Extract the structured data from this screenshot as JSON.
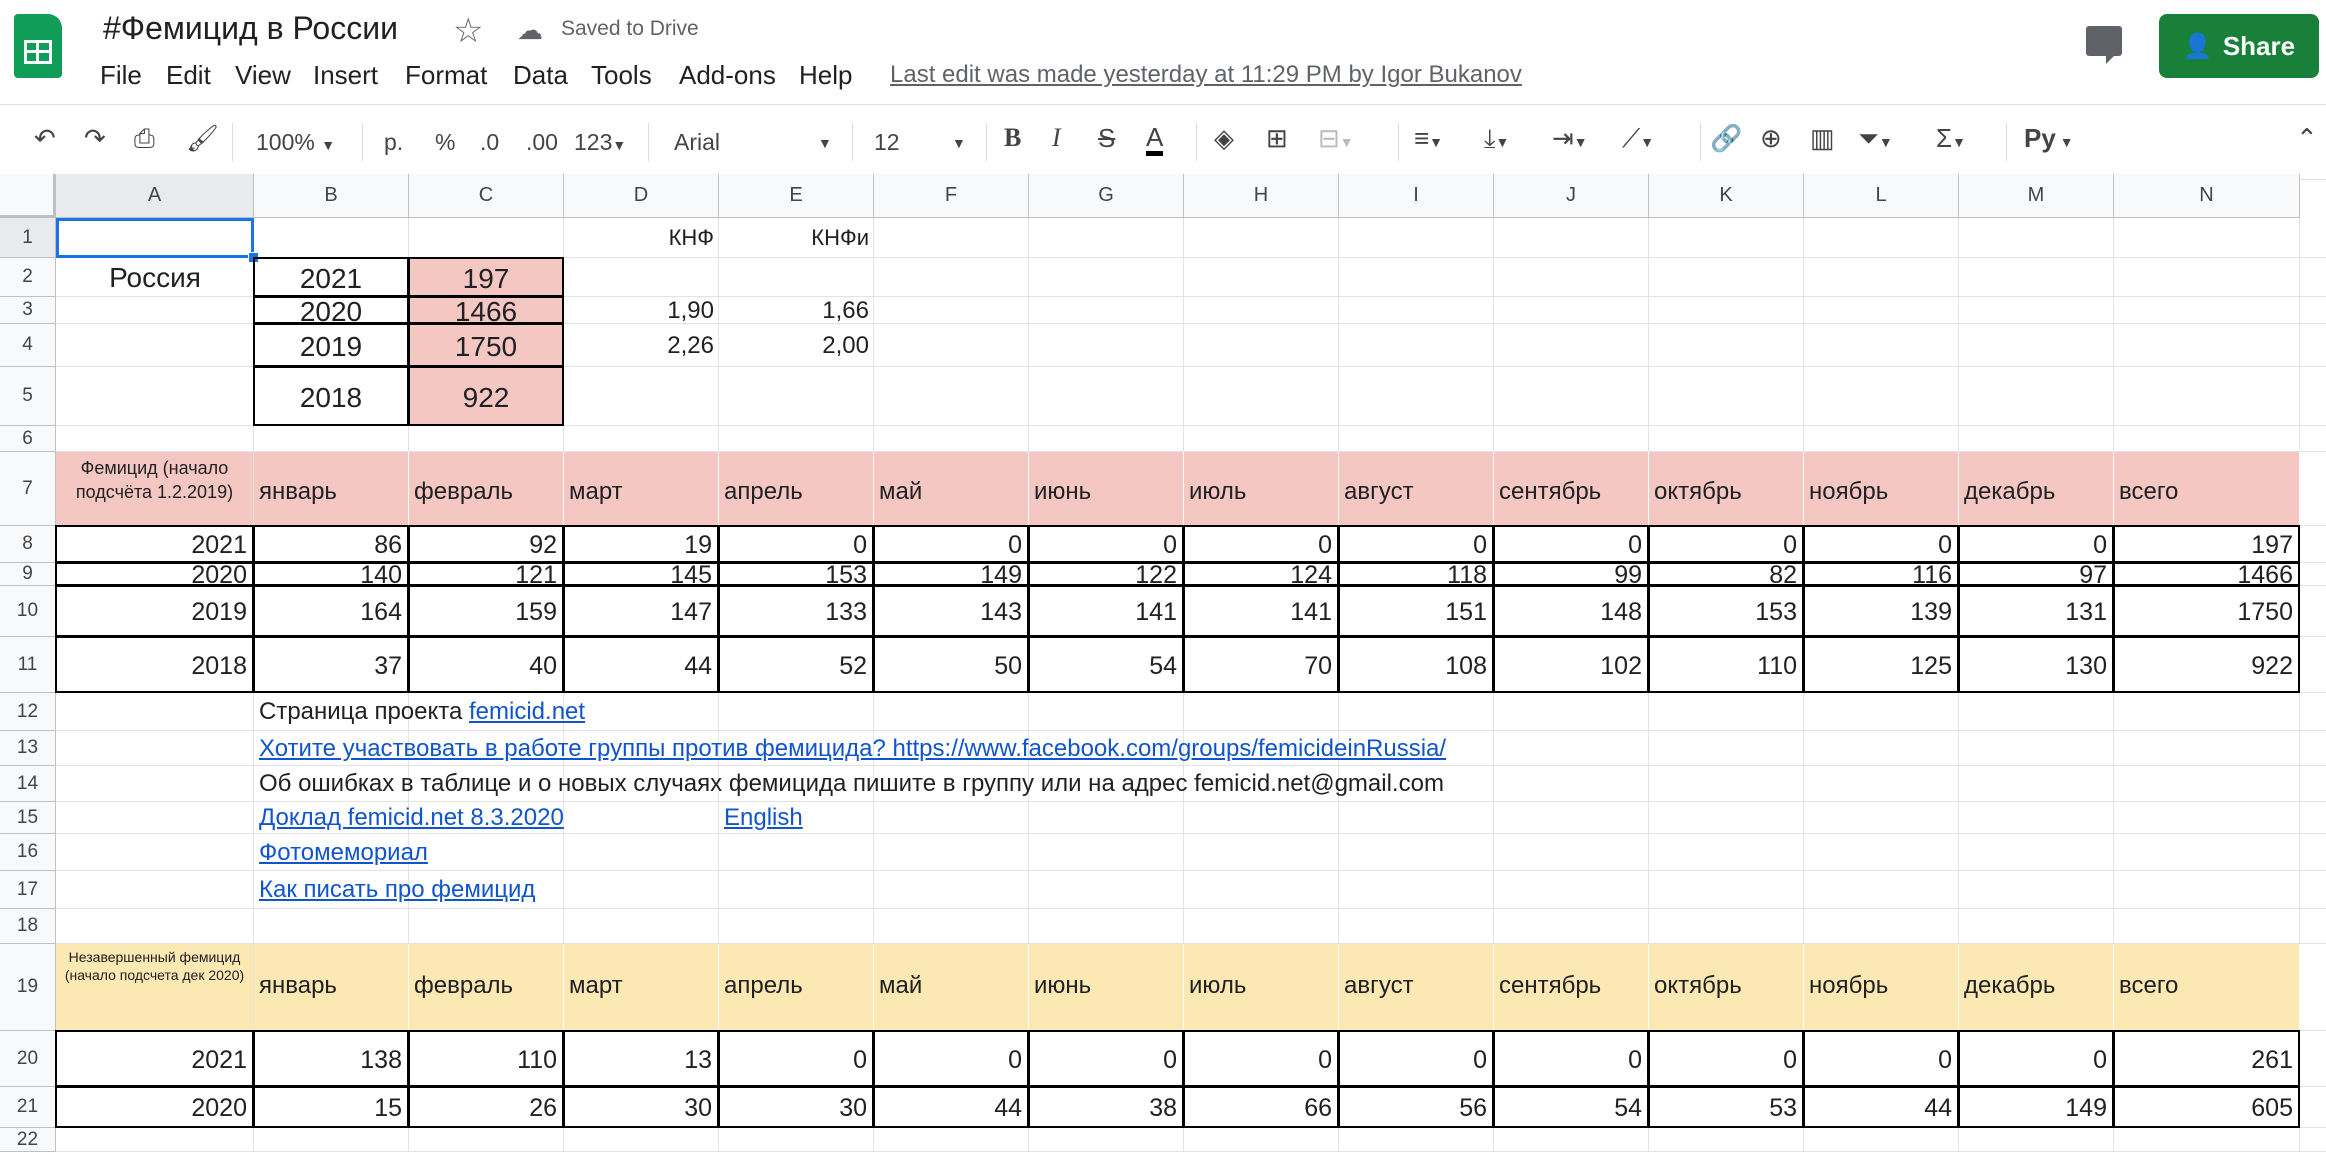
{
  "header": {
    "doc_title": "#Фемицид в России",
    "saved_status": "Saved to Drive",
    "last_edit": "Last edit was made yesterday at 11:29 PM by Igor Bukanov",
    "share_label": "Share",
    "menu": [
      "File",
      "Edit",
      "View",
      "Insert",
      "Format",
      "Data",
      "Tools",
      "Add-ons",
      "Help"
    ]
  },
  "toolbar": {
    "zoom": "100%",
    "currency": "р.",
    "percent": "%",
    "dec_less": ".0",
    "dec_more": ".00",
    "format_more": "123",
    "font": "Arial",
    "font_size": "12",
    "input_tools": "Рy"
  },
  "columns": [
    "A",
    "B",
    "C",
    "D",
    "E",
    "F",
    "G",
    "H",
    "I",
    "J",
    "K",
    "L",
    "M",
    "N"
  ],
  "rows": [
    "1",
    "2",
    "3",
    "4",
    "5",
    "6",
    "7",
    "8",
    "9",
    "10",
    "11",
    "12",
    "13",
    "14",
    "15",
    "16",
    "17",
    "18",
    "19",
    "20",
    "21",
    "22"
  ],
  "summary": {
    "knf_label": "КНФ",
    "knfi_label": "КНФи",
    "country": "Россия",
    "years": [
      {
        "year": "2021",
        "total": "197",
        "knf": "",
        "knfi": ""
      },
      {
        "year": "2020",
        "total": "1466",
        "knf": "1,90",
        "knfi": "1,66"
      },
      {
        "year": "2019",
        "total": "1750",
        "knf": "2,26",
        "knfi": "2,00"
      },
      {
        "year": "2018",
        "total": "922",
        "knf": "",
        "knfi": ""
      }
    ]
  },
  "femicide_table": {
    "title": "Фемицид (начало подсчёта 1.2.2019)",
    "headers": [
      "январь",
      "февраль",
      "март",
      "апрель",
      "май",
      "июнь",
      "июль",
      "август",
      "сентябрь",
      "октябрь",
      "ноябрь",
      "декабрь",
      "всего"
    ],
    "rows": [
      {
        "year": "2021",
        "values": [
          "86",
          "92",
          "19",
          "0",
          "0",
          "0",
          "0",
          "0",
          "0",
          "0",
          "0",
          "0",
          "197"
        ]
      },
      {
        "year": "2020",
        "values": [
          "140",
          "121",
          "145",
          "153",
          "149",
          "122",
          "124",
          "118",
          "99",
          "82",
          "116",
          "97",
          "1466"
        ]
      },
      {
        "year": "2019",
        "values": [
          "164",
          "159",
          "147",
          "133",
          "143",
          "141",
          "141",
          "151",
          "148",
          "153",
          "139",
          "131",
          "1750"
        ]
      },
      {
        "year": "2018",
        "values": [
          "37",
          "40",
          "44",
          "52",
          "50",
          "54",
          "70",
          "108",
          "102",
          "110",
          "125",
          "130",
          "922"
        ]
      }
    ]
  },
  "links": {
    "project_prefix": "Страница проекта ",
    "project_link": "femicid.net",
    "join_group": "Хотите участвовать в работе группы против фемицида? https://www.facebook.com/groups/femicideinRussia/",
    "errors_note": "Об ошибках в таблице и о новых случаях фемицида пишите в группу или на адрес femicid.net@gmail.com",
    "report": "Доклад femicid.net 8.3.2020",
    "english": "English",
    "memorial": "Фотомемориал ",
    "how_to_write": "Как писать про фемицид"
  },
  "attempted_table": {
    "title": "Незавершенный фемицид (начало подсчета дек 2020)",
    "headers": [
      "январь",
      "февраль",
      "март",
      "апрель",
      "май",
      "июнь",
      "июль",
      "август",
      "сентябрь",
      "октябрь",
      "ноябрь",
      "декабрь",
      "всего"
    ],
    "rows": [
      {
        "year": "2021",
        "values": [
          "138",
          "110",
          "13",
          "0",
          "0",
          "0",
          "0",
          "0",
          "0",
          "0",
          "0",
          "0",
          "261"
        ]
      },
      {
        "year": "2020",
        "values": [
          "15",
          "26",
          "30",
          "30",
          "44",
          "38",
          "66",
          "56",
          "54",
          "53",
          "44",
          "149",
          "605"
        ]
      }
    ]
  },
  "colors": {
    "pink_fill": "#f4c7c3",
    "yellow_fill": "#fce8b2",
    "share_green": "#188038",
    "link_blue": "#1155cc"
  }
}
